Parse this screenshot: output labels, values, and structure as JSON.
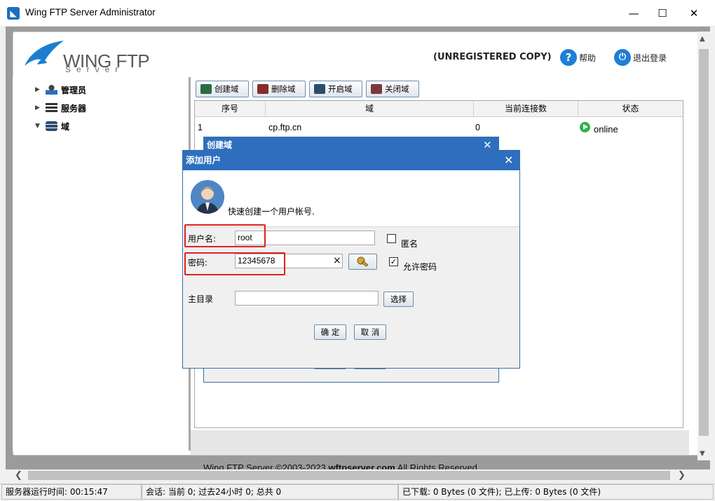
{
  "window": {
    "title": "Wing FTP Server Administrator",
    "controls": {
      "minimize": "—",
      "maximize": "☐",
      "close": "✕"
    }
  },
  "header": {
    "logo_text": "WING FTP",
    "logo_sub": "Server",
    "unregistered": "(UNREGISTERED COPY)",
    "help_label": "帮助",
    "logout_label": "退出登录"
  },
  "tree": {
    "items": [
      {
        "label": "管理员",
        "icon": "admin-icon",
        "expanded": false
      },
      {
        "label": "服务器",
        "icon": "server-icon",
        "expanded": false
      },
      {
        "label": "域",
        "icon": "domain-icon",
        "expanded": true
      }
    ]
  },
  "toolbar": {
    "create": "创建域",
    "delete": "删除域",
    "start": "开启域",
    "stop": "关闭域"
  },
  "table": {
    "columns": [
      "序号",
      "域",
      "当前连接数",
      "状态"
    ],
    "rows": [
      {
        "id": "1",
        "domain": "cp.ftp.cn",
        "connections": "0",
        "status": "online"
      }
    ]
  },
  "back_dialog": {
    "title": "创建域",
    "close": "✕"
  },
  "dialog": {
    "title": "添加用户",
    "close": "✕",
    "subtitle": "快速创建一个用户帐号.",
    "username_label": "用户名:",
    "username_value": "root",
    "anonymous_label": "匿名",
    "anonymous_checked": false,
    "password_label": "密码:",
    "password_value": "12345678",
    "clear_symbol": "×",
    "allow_password_label": "允许密码",
    "allow_password_checked": true,
    "home_label": "主目录",
    "home_value": "",
    "browse_label": "选择",
    "ok_label": "确 定",
    "cancel_label": "取 消"
  },
  "footer": {
    "copyright_plain": "Wing FTP Server ©2003-2023 ",
    "copyright_bold": "wftpserver.com",
    "copyright_tail": " All Rights Reserved"
  },
  "statusbar": {
    "uptime": "服务器运行时间: 00:15:47",
    "sessions": "会话: 当前 0;  过去24小时 0;  总共 0",
    "transfer": "已下载: 0 Bytes (0 文件);  已上传: 0 Bytes (0 文件)"
  },
  "colors": {
    "accent": "#2d6fbe",
    "online": "#2fb34a",
    "highlight": "#e02020"
  }
}
